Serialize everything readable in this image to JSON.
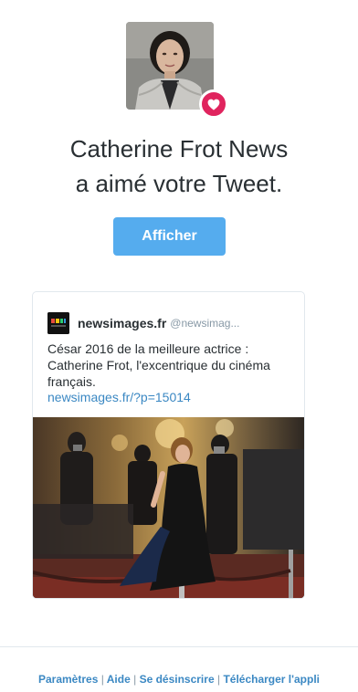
{
  "notification": {
    "line1": "Catherine Frot News",
    "line2": "a aimé votre Tweet.",
    "button_label": "Afficher"
  },
  "tweet": {
    "author_name": "newsimages.fr",
    "author_handle": "@newsimag...",
    "text": "César 2016 de la meilleure actrice : Catherine Frot, l'excentrique du cinéma français.",
    "link": "newsimages.fr/?p=15014"
  },
  "footer": {
    "links": [
      "Paramètres",
      "Aide",
      "Se désinscrire",
      "Télécharger l'appli"
    ],
    "separator": "|"
  },
  "colors": {
    "accent": "#55acee",
    "heart": "#e0245e",
    "link": "#3b88c3"
  },
  "icons": {
    "badge": "heart-icon",
    "source_logo": "news-logo-icon"
  }
}
